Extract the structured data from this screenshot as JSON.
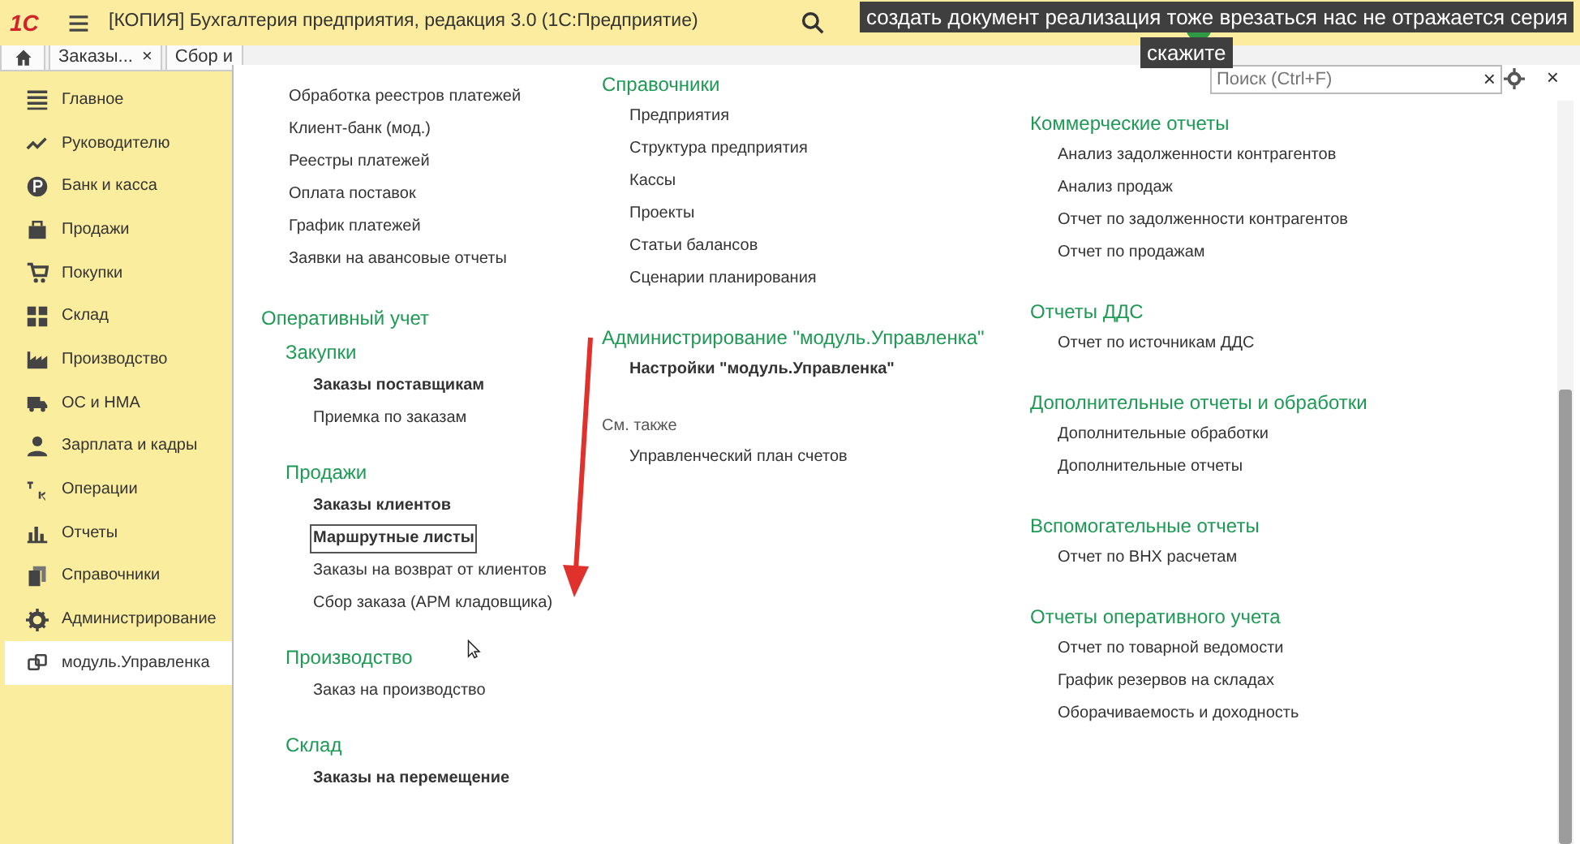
{
  "title_bar": {
    "logo": "1С",
    "title": "[КОПИЯ] Бухгалтерия предприятия, редакция 3.0  (1С:Предприятие)"
  },
  "video_captions": [
    "создать документ реализация тоже врезаться нас не отражается серия",
    "скажите"
  ],
  "tabs": [
    {
      "label": "Заказы...",
      "close": "×"
    },
    {
      "label": "Сбор и"
    }
  ],
  "sidebar": {
    "items": [
      {
        "label": "Главное",
        "selected": false
      },
      {
        "label": "Руководителю",
        "selected": false
      },
      {
        "label": "Банк и касса",
        "selected": false
      },
      {
        "label": "Продажи",
        "selected": false
      },
      {
        "label": "Покупки",
        "selected": false
      },
      {
        "label": "Склад",
        "selected": false
      },
      {
        "label": "Производство",
        "selected": false
      },
      {
        "label": "ОС и НМА",
        "selected": false
      },
      {
        "label": "Зарплата и кадры",
        "selected": false
      },
      {
        "label": "Операции",
        "selected": false
      },
      {
        "label": "Отчеты",
        "selected": false
      },
      {
        "label": "Справочники",
        "selected": false
      },
      {
        "label": "Администрирование",
        "selected": false
      },
      {
        "label": "модуль.Управленка",
        "selected": true
      }
    ]
  },
  "panel": {
    "search": {
      "placeholder": "Поиск (Ctrl+F)",
      "clear": "×"
    },
    "close": "×",
    "columns": [
      [
        {
          "kind": "section",
          "items": [
            {
              "label": "Обработка реестров платежей",
              "important": false,
              "focused": false
            },
            {
              "label": "Клиент-банк (мод.)",
              "important": false,
              "focused": false
            },
            {
              "label": "Реестры платежей",
              "important": false,
              "focused": false
            },
            {
              "label": "Оплата поставок",
              "important": false,
              "focused": false
            },
            {
              "label": "График платежей",
              "important": false,
              "focused": false
            },
            {
              "label": "Заявки на авансовые отчеты",
              "important": false,
              "focused": false
            }
          ]
        },
        {
          "kind": "section",
          "title": "Оперативный учет",
          "children": [
            {
              "kind": "group",
              "title": "Закупки",
              "items": [
                {
                  "label": "Заказы поставщикам",
                  "important": true,
                  "focused": false
                },
                {
                  "label": "Приемка по заказам",
                  "important": false,
                  "focused": false
                }
              ]
            },
            {
              "kind": "group",
              "title": "Продажи",
              "items": [
                {
                  "label": "Заказы клиентов",
                  "important": true,
                  "focused": false
                },
                {
                  "label": "Маршрутные листы",
                  "important": true,
                  "focused": true
                },
                {
                  "label": "Заказы на возврат от клиентов",
                  "important": false,
                  "focused": false
                },
                {
                  "label": "Сбор заказа (АРМ кладовщика)",
                  "important": false,
                  "focused": false
                }
              ]
            },
            {
              "kind": "group",
              "title": "Производство",
              "items": [
                {
                  "label": "Заказ на производство",
                  "important": false,
                  "focused": false
                }
              ]
            },
            {
              "kind": "group",
              "title": "Склад",
              "items": [
                {
                  "label": "Заказы на перемещение",
                  "important": true,
                  "focused": false
                }
              ]
            }
          ]
        }
      ],
      [
        {
          "kind": "section",
          "title": "Справочники",
          "items": [
            {
              "label": "Предприятия",
              "important": false,
              "focused": false
            },
            {
              "label": "Структура предприятия",
              "important": false,
              "focused": false
            },
            {
              "label": "Кассы",
              "important": false,
              "focused": false
            },
            {
              "label": "Проекты",
              "important": false,
              "focused": false
            },
            {
              "label": "Статьи балансов",
              "important": false,
              "focused": false
            },
            {
              "label": "Сценарии планирования",
              "important": false,
              "focused": false
            }
          ]
        },
        {
          "kind": "section",
          "title": "Администрирование \"модуль.Управленка\"",
          "items": [
            {
              "label": "Настройки \"модуль.Управленка\"",
              "important": true,
              "focused": false
            }
          ]
        },
        {
          "kind": "see_also",
          "title": "См. также",
          "items": [
            {
              "label": "Управленческий план счетов",
              "important": false,
              "focused": false
            }
          ]
        }
      ],
      [
        {
          "kind": "section",
          "title": "Коммерческие отчеты",
          "items": [
            {
              "label": "Анализ задолженности контрагентов",
              "important": false,
              "focused": false
            },
            {
              "label": "Анализ продаж",
              "important": false,
              "focused": false
            },
            {
              "label": "Отчет по задолженности контрагентов",
              "important": false,
              "focused": false
            },
            {
              "label": "Отчет по продажам",
              "important": false,
              "focused": false
            }
          ]
        },
        {
          "kind": "section",
          "title": "Отчеты ДДС",
          "items": [
            {
              "label": "Отчет по источникам ДДС",
              "important": false,
              "focused": false
            }
          ]
        },
        {
          "kind": "section",
          "title": "Дополнительные отчеты и обработки",
          "items": [
            {
              "label": "Дополнительные обработки",
              "important": false,
              "focused": false
            },
            {
              "label": "Дополнительные отчеты",
              "important": false,
              "focused": false
            }
          ]
        },
        {
          "kind": "section",
          "title": "Вспомогательные отчеты",
          "items": [
            {
              "label": "Отчет по ВНХ расчетам",
              "important": false,
              "focused": false
            }
          ]
        },
        {
          "kind": "section",
          "title": "Отчеты оперативного учета",
          "items": [
            {
              "label": "Отчет по товарной ведомости",
              "important": false,
              "focused": false
            },
            {
              "label": "График резервов на складах",
              "important": false,
              "focused": false
            },
            {
              "label": "Оборачиваемость и доходность",
              "important": false,
              "focused": false
            }
          ]
        }
      ]
    ]
  }
}
